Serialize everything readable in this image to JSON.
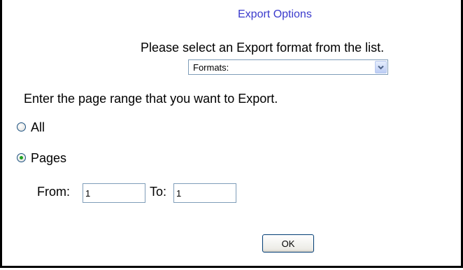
{
  "dialog": {
    "title": "Export Options",
    "instruction": "Please select an Export format from the list."
  },
  "format_select": {
    "value": "Formats:"
  },
  "range": {
    "label": "Enter the page range that you want to Export.",
    "options": [
      {
        "label": "All",
        "checked": false
      },
      {
        "label": "Pages",
        "checked": true
      }
    ],
    "from_label": "From:",
    "from_value": "1",
    "to_label": "To:",
    "to_value": "1"
  },
  "buttons": {
    "ok_label": "OK"
  },
  "colors": {
    "title": "#3a3acc",
    "radio_dot": "#21a121",
    "input_border": "#7f9db9"
  },
  "icons": {
    "select_arrow": "chevron-down-icon"
  }
}
